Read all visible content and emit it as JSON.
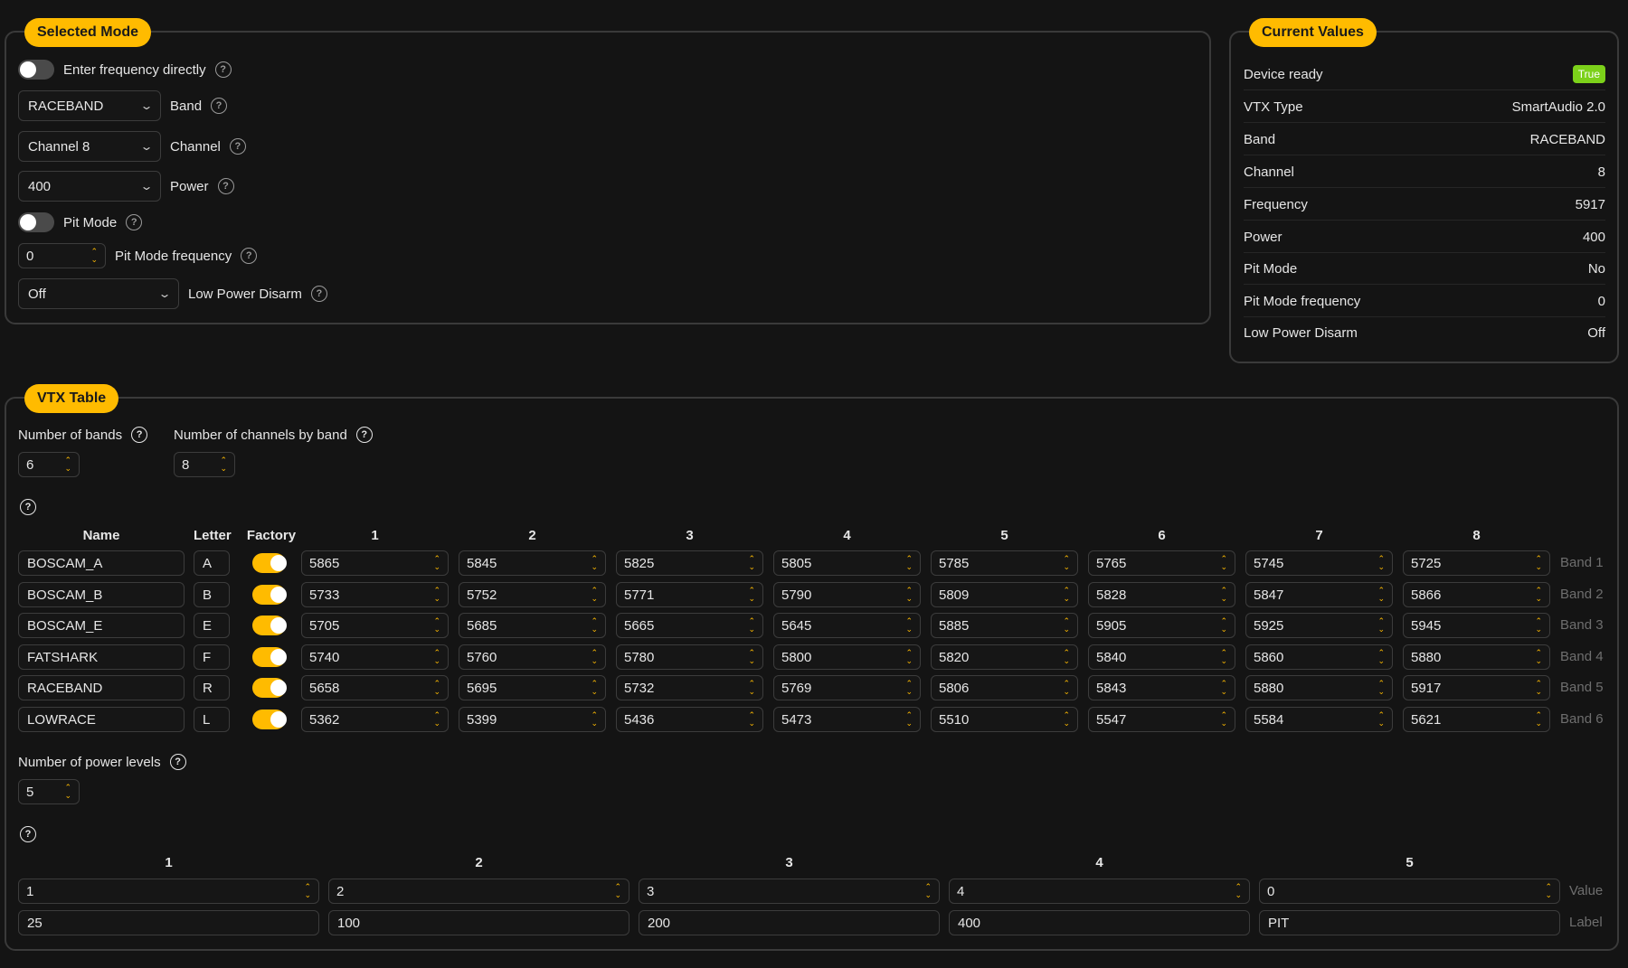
{
  "selected_mode": {
    "title": "Selected Mode",
    "enter_freq_label": "Enter frequency directly",
    "enter_freq_on": false,
    "band_value": "RACEBAND",
    "band_label": "Band",
    "channel_value": "Channel 8",
    "channel_label": "Channel",
    "power_value": "400",
    "power_label": "Power",
    "pit_mode_label": "Pit Mode",
    "pit_mode_on": false,
    "pit_freq_value": "0",
    "pit_freq_label": "Pit Mode frequency",
    "low_power_value": "Off",
    "low_power_label": "Low Power Disarm"
  },
  "current_values": {
    "title": "Current Values",
    "rows": [
      {
        "key": "Device ready",
        "value": "True"
      },
      {
        "key": "VTX Type",
        "value": "SmartAudio 2.0"
      },
      {
        "key": "Band",
        "value": "RACEBAND"
      },
      {
        "key": "Channel",
        "value": "8"
      },
      {
        "key": "Frequency",
        "value": "5917"
      },
      {
        "key": "Power",
        "value": "400"
      },
      {
        "key": "Pit Mode",
        "value": "No"
      },
      {
        "key": "Pit Mode frequency",
        "value": "0"
      },
      {
        "key": "Low Power Disarm",
        "value": "Off"
      }
    ]
  },
  "vtx_table": {
    "title": "VTX Table",
    "num_bands_label": "Number of bands",
    "num_bands_value": "6",
    "num_channels_label": "Number of channels by band",
    "num_channels_value": "8",
    "headers": {
      "name": "Name",
      "letter": "Letter",
      "factory": "Factory",
      "channels": [
        "1",
        "2",
        "3",
        "4",
        "5",
        "6",
        "7",
        "8"
      ]
    },
    "bands": [
      {
        "name": "BOSCAM_A",
        "letter": "A",
        "factory": true,
        "freqs": [
          "5865",
          "5845",
          "5825",
          "5805",
          "5785",
          "5765",
          "5745",
          "5725"
        ],
        "label": "Band 1"
      },
      {
        "name": "BOSCAM_B",
        "letter": "B",
        "factory": true,
        "freqs": [
          "5733",
          "5752",
          "5771",
          "5790",
          "5809",
          "5828",
          "5847",
          "5866"
        ],
        "label": "Band 2"
      },
      {
        "name": "BOSCAM_E",
        "letter": "E",
        "factory": true,
        "freqs": [
          "5705",
          "5685",
          "5665",
          "5645",
          "5885",
          "5905",
          "5925",
          "5945"
        ],
        "label": "Band 3"
      },
      {
        "name": "FATSHARK",
        "letter": "F",
        "factory": true,
        "freqs": [
          "5740",
          "5760",
          "5780",
          "5800",
          "5820",
          "5840",
          "5860",
          "5880"
        ],
        "label": "Band 4"
      },
      {
        "name": "RACEBAND",
        "letter": "R",
        "factory": true,
        "freqs": [
          "5658",
          "5695",
          "5732",
          "5769",
          "5806",
          "5843",
          "5880",
          "5917"
        ],
        "label": "Band 5"
      },
      {
        "name": "LOWRACE",
        "letter": "L",
        "factory": true,
        "freqs": [
          "5362",
          "5399",
          "5436",
          "5473",
          "5510",
          "5547",
          "5584",
          "5621"
        ],
        "label": "Band 6"
      }
    ],
    "num_power_label": "Number of power levels",
    "num_power_value": "5",
    "power_headers": [
      "1",
      "2",
      "3",
      "4",
      "5"
    ],
    "power_values": [
      "1",
      "2",
      "3",
      "4",
      "0"
    ],
    "power_labels": [
      "25",
      "100",
      "200",
      "400",
      "PIT"
    ],
    "value_row_label": "Value",
    "label_row_label": "Label"
  }
}
